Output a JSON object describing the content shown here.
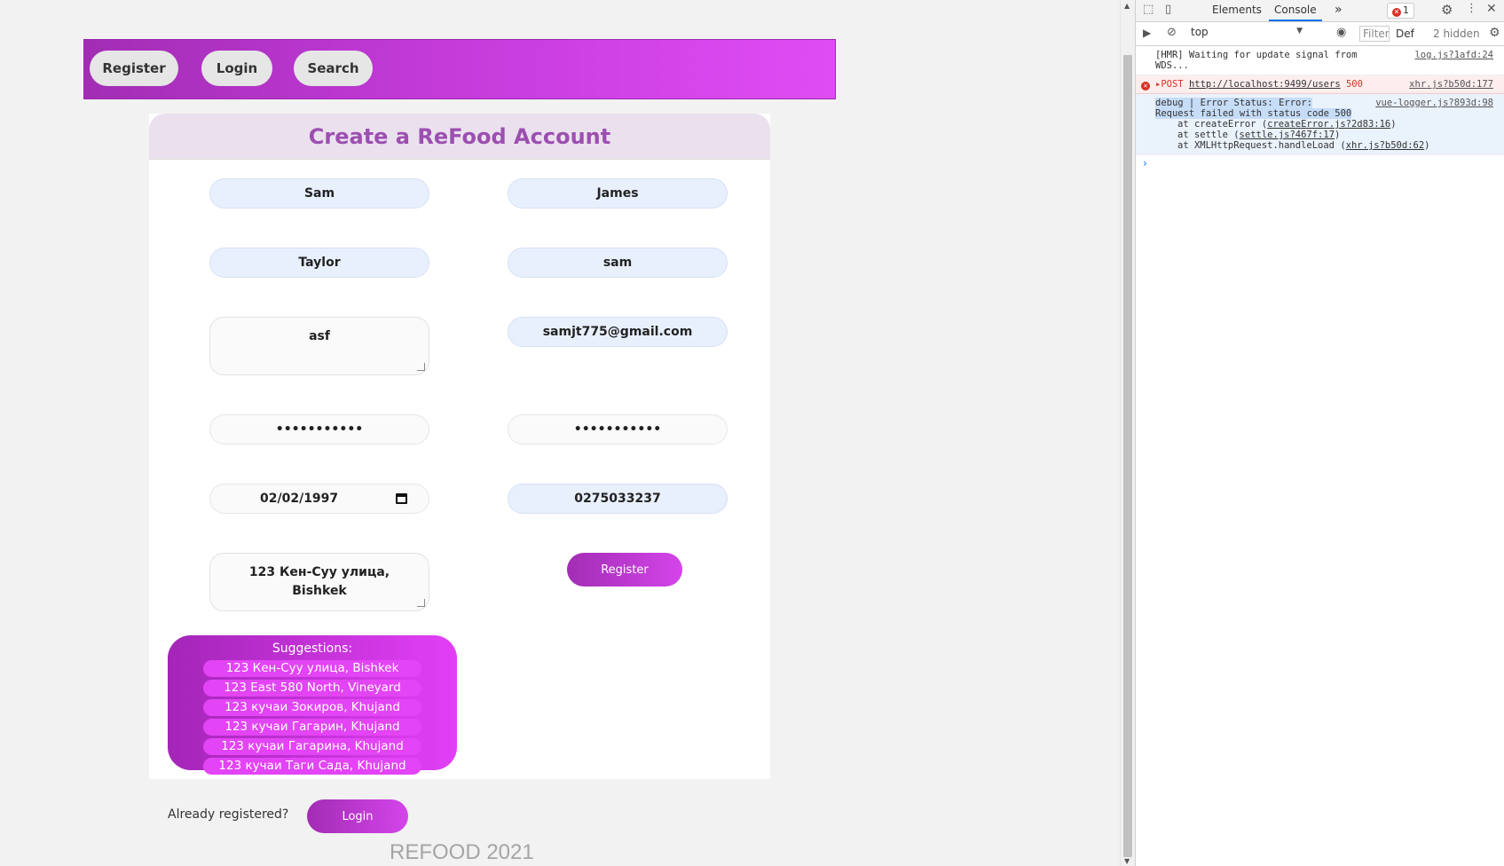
{
  "nav": {
    "register": "Register",
    "login": "Login",
    "search": "Search"
  },
  "form": {
    "title": "Create a ReFood Account",
    "first_name": "Sam",
    "middle_name": "James",
    "last_name": "Taylor",
    "username": "sam",
    "bio": "asf",
    "email": "samjt775@gmail.com",
    "password": "•••••••••••",
    "confirm_password": "•••••••••••",
    "dob": "02/02/1997",
    "phone": "0275033237",
    "address": "123 Кен-Суу улица,\nBishkek",
    "register_button": "Register"
  },
  "suggestions": {
    "title": "Suggestions:",
    "items": [
      "123 Кен-Суу улица, Bishkek",
      "123 East 580 North, Vineyard",
      "123 кучаи Зокиров, Khujand",
      "123 кучаи Гагарин, Khujand",
      "123 кучаи Гагарина, Khujand",
      "123 кучаи Таги Сада, Khujand"
    ]
  },
  "bottom": {
    "already": "Already registered?",
    "login_button": "Login",
    "footer": "REFOOD 2021"
  },
  "devtools": {
    "tabs": {
      "elements": "Elements",
      "console": "Console",
      "more": "»"
    },
    "error_count": "1",
    "context": "top",
    "filter_placeholder": "Filter",
    "levels": "Def",
    "hidden": "2 hidden",
    "console": {
      "hmr_line1": "[HMR] Waiting for update signal from",
      "hmr_line2": "WDS...",
      "hmr_src": "log.js?1afd:24",
      "post_method": "POST",
      "post_url": "http://localhost:9499/users",
      "post_status": "500",
      "post_src": "xhr.js?b50d:177",
      "debug_line1": "debug |   Error Status: Error: ",
      "debug_line2": "Request failed with status code 500",
      "debug_src": "vue-logger.js?893d:98",
      "stack1_pre": "at createError (",
      "stack1_link": "createError.js?2d83:16",
      "stack2_pre": "at settle (",
      "stack2_link": "settle.js?467f:17",
      "stack3_pre": "at XMLHttpRequest.handleLoad (",
      "stack3_link": "xhr.js?b50d:62",
      "close_paren": ")"
    }
  }
}
